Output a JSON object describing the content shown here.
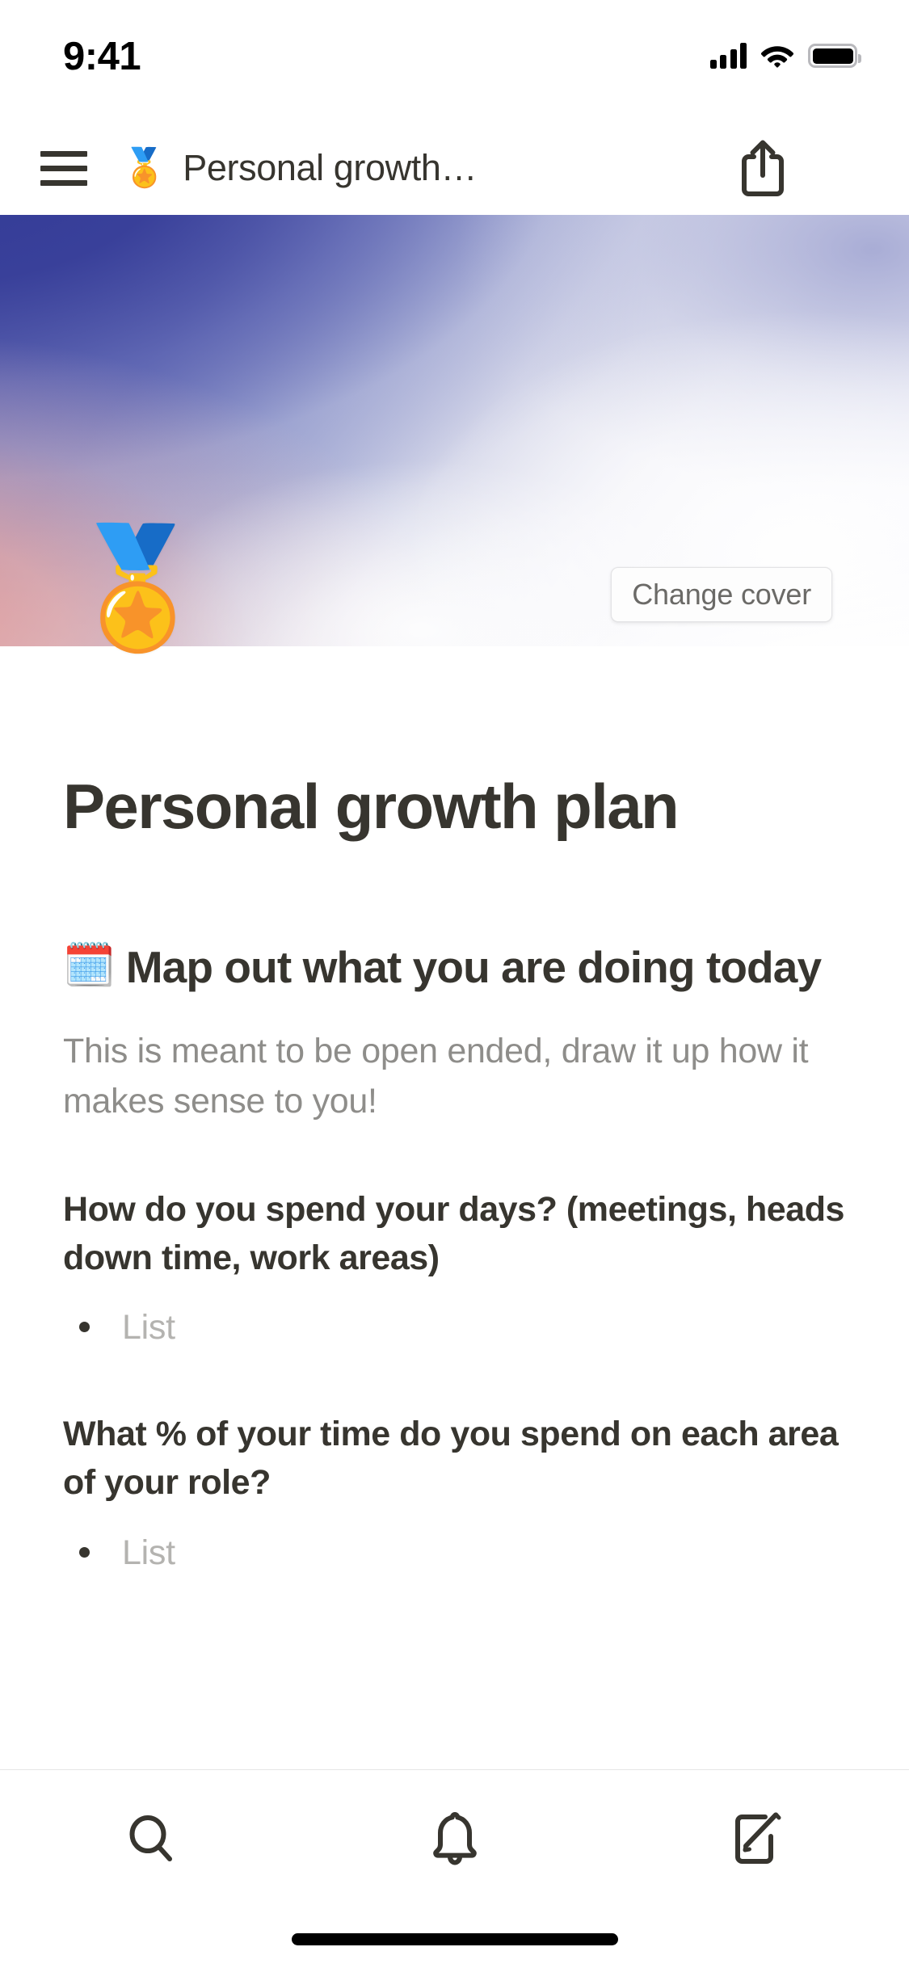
{
  "status_bar": {
    "time": "9:41",
    "cellular_icon": "cellular-signal-icon",
    "wifi_icon": "wifi-icon",
    "battery_icon": "battery-full-icon"
  },
  "nav": {
    "menu_icon": "hamburger-menu-icon",
    "page_emoji": "🏅",
    "title": "Personal growth…",
    "share_icon": "share-icon"
  },
  "cover": {
    "change_cover_label": "Change cover",
    "colors": {
      "indigo": "#3b4099",
      "salmon": "#ec968c",
      "lavender": "#c3c6e0",
      "white": "#ffffff"
    }
  },
  "page": {
    "icon_emoji": "🏅",
    "title": "Personal growth plan"
  },
  "blocks": [
    {
      "type": "heading",
      "emoji": "🗓️",
      "text": "Map out what you are doing today"
    },
    {
      "type": "paragraph",
      "text": "This is meant to be open ended, draw it up how it makes sense to you!"
    },
    {
      "type": "question",
      "text": "How do you spend your days? (meetings, heads down time, work areas)"
    },
    {
      "type": "bullet",
      "text": "List"
    },
    {
      "type": "question",
      "text": "What % of your time do you spend on each area of your role?"
    },
    {
      "type": "bullet",
      "text": "List"
    }
  ],
  "tab_bar": {
    "items": [
      {
        "name": "search",
        "icon": "search-icon"
      },
      {
        "name": "notifications",
        "icon": "bell-icon"
      },
      {
        "name": "new-note",
        "icon": "compose-icon"
      }
    ]
  },
  "theme": {
    "text_primary": "#37352f",
    "text_muted": "#8e8d8a",
    "text_placeholder": "#b4b3b0",
    "background": "#ffffff",
    "divider": "#e6e6e6"
  }
}
